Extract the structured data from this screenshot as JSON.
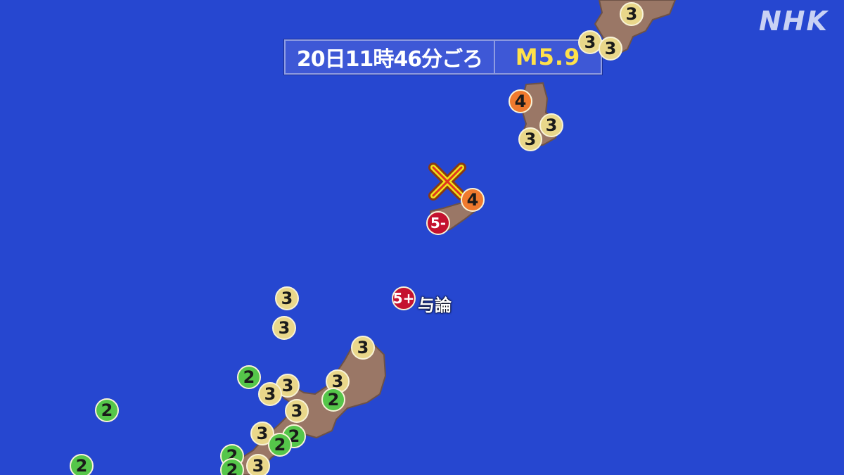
{
  "broadcaster": {
    "logo_text": "NHK"
  },
  "earthquake": {
    "time_label": "20日11時46分ごろ",
    "magnitude_label": "M5.9"
  },
  "epicenter": {
    "icon": "x-mark-icon",
    "color": "#f0e21a"
  },
  "place_labels": [
    {
      "name": "与論"
    }
  ],
  "intensity_markers": [
    {
      "level": "3"
    },
    {
      "level": "3"
    },
    {
      "level": "3"
    },
    {
      "level": "4"
    },
    {
      "level": "3"
    },
    {
      "level": "3"
    },
    {
      "level": "4"
    },
    {
      "level": "5-"
    },
    {
      "level": "5+"
    },
    {
      "level": "3"
    },
    {
      "level": "3"
    },
    {
      "level": "3"
    },
    {
      "level": "2"
    },
    {
      "level": "3"
    },
    {
      "level": "3"
    },
    {
      "level": "3"
    },
    {
      "level": "2"
    },
    {
      "level": "3"
    },
    {
      "level": "2"
    },
    {
      "level": "3"
    },
    {
      "level": "2"
    },
    {
      "level": "2"
    },
    {
      "level": "2"
    },
    {
      "level": "2"
    },
    {
      "level": "3"
    },
    {
      "level": "2"
    }
  ],
  "colors": {
    "sea": "#2647d0",
    "land": "#9a7766",
    "intensity_2": "#55c64a",
    "intensity_3": "#e9d78a",
    "intensity_4": "#ef7a2e",
    "intensity_5": "#c4122f",
    "magnitude_text": "#ffe14a"
  }
}
